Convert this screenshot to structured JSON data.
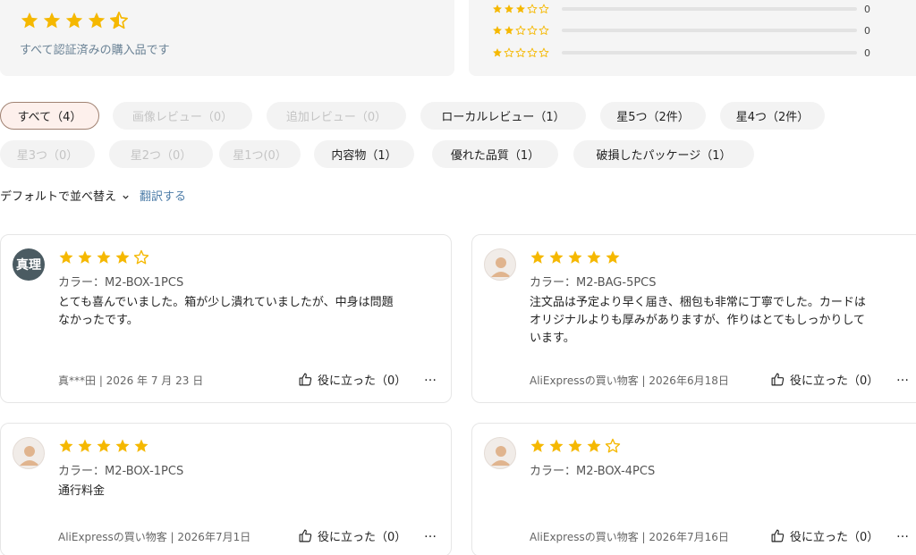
{
  "summary": {
    "overall_stars": 4.5,
    "verified_text": "すべて認証済みの購入品です",
    "distribution": [
      {
        "stars": 3,
        "count": "0",
        "fraction": 0
      },
      {
        "stars": 2,
        "count": "0",
        "fraction": 0
      },
      {
        "stars": 1,
        "count": "0",
        "fraction": 0
      }
    ]
  },
  "filters": {
    "row1": [
      {
        "label": "すべて（4）",
        "state": "active"
      },
      {
        "label": "画像レビュー（0）",
        "state": "disabled"
      },
      {
        "label": "追加レビュー（0）",
        "state": "disabled"
      },
      {
        "label": "ローカルレビュー（1）",
        "state": "normal"
      },
      {
        "label": "星5つ（2件）",
        "state": "normal"
      },
      {
        "label": "星4つ（2件）",
        "state": "normal"
      }
    ],
    "row2": [
      {
        "label": "星3つ（0）",
        "state": "disabled"
      },
      {
        "label": "星2つ（0）",
        "state": "disabled"
      },
      {
        "label": "星1つ(0）",
        "state": "disabled"
      },
      {
        "label": "内容物（1）",
        "state": "normal"
      },
      {
        "label": "優れた品質（1）",
        "state": "normal"
      },
      {
        "label": "破損したパッケージ（1）",
        "state": "normal"
      }
    ]
  },
  "sort": {
    "label": "デフォルトで並べ替え",
    "chevron": "chevron-down-icon",
    "translate": "翻訳する"
  },
  "reviews": [
    {
      "avatar_type": "text",
      "avatar_text": "真理",
      "stars": 4,
      "color": "カラー：M2-BOX-1PCS",
      "text_lines": [
        "とても喜んでいました。箱が少し潰れていましたが、中身は問題",
        "なかったです。"
      ],
      "meta": "真***田 | 2026 年 7 月 23 日",
      "helpful": "役に立った（0）"
    },
    {
      "avatar_type": "image",
      "avatar_text": "",
      "stars": 5,
      "color": "カラー：M2-BAG-5PCS",
      "text_lines": [
        "注文品は予定より早く届き、梱包も非常に丁寧でした。カードは",
        "オリジナルよりも厚みがありますが、作りはとてもしっかりして",
        "います。"
      ],
      "meta": "AliExpressの買い物客 | 2026年6月18日",
      "helpful": "役に立った（0）"
    },
    {
      "avatar_type": "image",
      "avatar_text": "",
      "stars": 5,
      "color": "カラー：M2-BOX-1PCS",
      "text_lines": [
        "通行料金"
      ],
      "meta": "AliExpressの買い物客 | 2026年7月1日",
      "helpful": "役に立った（0）"
    },
    {
      "avatar_type": "image",
      "avatar_text": "",
      "stars": 4,
      "color": "カラー：M2-BOX-4PCS",
      "text_lines": [],
      "meta": "AliExpressの買い物客 | 2026年7月16日",
      "helpful": "役に立った（0）"
    }
  ],
  "colors": {
    "star": "#f5b800",
    "star_outline": "#f5b800",
    "link": "#4e7da8",
    "active_chip_border": "#a08272"
  },
  "icons": {
    "more": "…",
    "helpful": "thumbs-up-icon"
  }
}
